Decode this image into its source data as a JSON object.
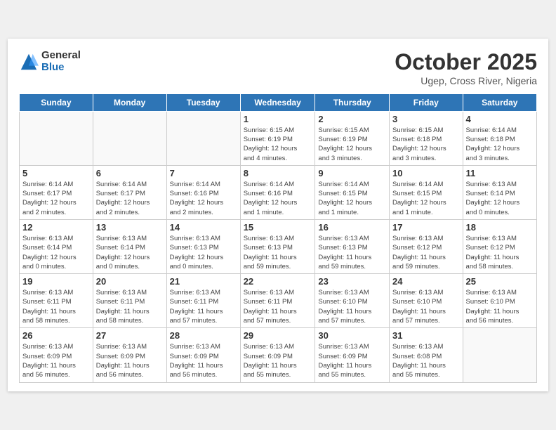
{
  "header": {
    "logo_general": "General",
    "logo_blue": "Blue",
    "month_title": "October 2025",
    "location": "Ugep, Cross River, Nigeria"
  },
  "weekdays": [
    "Sunday",
    "Monday",
    "Tuesday",
    "Wednesday",
    "Thursday",
    "Friday",
    "Saturday"
  ],
  "weeks": [
    [
      {
        "day": "",
        "info": ""
      },
      {
        "day": "",
        "info": ""
      },
      {
        "day": "",
        "info": ""
      },
      {
        "day": "1",
        "info": "Sunrise: 6:15 AM\nSunset: 6:19 PM\nDaylight: 12 hours\nand 4 minutes."
      },
      {
        "day": "2",
        "info": "Sunrise: 6:15 AM\nSunset: 6:19 PM\nDaylight: 12 hours\nand 3 minutes."
      },
      {
        "day": "3",
        "info": "Sunrise: 6:15 AM\nSunset: 6:18 PM\nDaylight: 12 hours\nand 3 minutes."
      },
      {
        "day": "4",
        "info": "Sunrise: 6:14 AM\nSunset: 6:18 PM\nDaylight: 12 hours\nand 3 minutes."
      }
    ],
    [
      {
        "day": "5",
        "info": "Sunrise: 6:14 AM\nSunset: 6:17 PM\nDaylight: 12 hours\nand 2 minutes."
      },
      {
        "day": "6",
        "info": "Sunrise: 6:14 AM\nSunset: 6:17 PM\nDaylight: 12 hours\nand 2 minutes."
      },
      {
        "day": "7",
        "info": "Sunrise: 6:14 AM\nSunset: 6:16 PM\nDaylight: 12 hours\nand 2 minutes."
      },
      {
        "day": "8",
        "info": "Sunrise: 6:14 AM\nSunset: 6:16 PM\nDaylight: 12 hours\nand 1 minute."
      },
      {
        "day": "9",
        "info": "Sunrise: 6:14 AM\nSunset: 6:15 PM\nDaylight: 12 hours\nand 1 minute."
      },
      {
        "day": "10",
        "info": "Sunrise: 6:14 AM\nSunset: 6:15 PM\nDaylight: 12 hours\nand 1 minute."
      },
      {
        "day": "11",
        "info": "Sunrise: 6:13 AM\nSunset: 6:14 PM\nDaylight: 12 hours\nand 0 minutes."
      }
    ],
    [
      {
        "day": "12",
        "info": "Sunrise: 6:13 AM\nSunset: 6:14 PM\nDaylight: 12 hours\nand 0 minutes."
      },
      {
        "day": "13",
        "info": "Sunrise: 6:13 AM\nSunset: 6:14 PM\nDaylight: 12 hours\nand 0 minutes."
      },
      {
        "day": "14",
        "info": "Sunrise: 6:13 AM\nSunset: 6:13 PM\nDaylight: 12 hours\nand 0 minutes."
      },
      {
        "day": "15",
        "info": "Sunrise: 6:13 AM\nSunset: 6:13 PM\nDaylight: 11 hours\nand 59 minutes."
      },
      {
        "day": "16",
        "info": "Sunrise: 6:13 AM\nSunset: 6:13 PM\nDaylight: 11 hours\nand 59 minutes."
      },
      {
        "day": "17",
        "info": "Sunrise: 6:13 AM\nSunset: 6:12 PM\nDaylight: 11 hours\nand 59 minutes."
      },
      {
        "day": "18",
        "info": "Sunrise: 6:13 AM\nSunset: 6:12 PM\nDaylight: 11 hours\nand 58 minutes."
      }
    ],
    [
      {
        "day": "19",
        "info": "Sunrise: 6:13 AM\nSunset: 6:11 PM\nDaylight: 11 hours\nand 58 minutes."
      },
      {
        "day": "20",
        "info": "Sunrise: 6:13 AM\nSunset: 6:11 PM\nDaylight: 11 hours\nand 58 minutes."
      },
      {
        "day": "21",
        "info": "Sunrise: 6:13 AM\nSunset: 6:11 PM\nDaylight: 11 hours\nand 57 minutes."
      },
      {
        "day": "22",
        "info": "Sunrise: 6:13 AM\nSunset: 6:11 PM\nDaylight: 11 hours\nand 57 minutes."
      },
      {
        "day": "23",
        "info": "Sunrise: 6:13 AM\nSunset: 6:10 PM\nDaylight: 11 hours\nand 57 minutes."
      },
      {
        "day": "24",
        "info": "Sunrise: 6:13 AM\nSunset: 6:10 PM\nDaylight: 11 hours\nand 57 minutes."
      },
      {
        "day": "25",
        "info": "Sunrise: 6:13 AM\nSunset: 6:10 PM\nDaylight: 11 hours\nand 56 minutes."
      }
    ],
    [
      {
        "day": "26",
        "info": "Sunrise: 6:13 AM\nSunset: 6:09 PM\nDaylight: 11 hours\nand 56 minutes."
      },
      {
        "day": "27",
        "info": "Sunrise: 6:13 AM\nSunset: 6:09 PM\nDaylight: 11 hours\nand 56 minutes."
      },
      {
        "day": "28",
        "info": "Sunrise: 6:13 AM\nSunset: 6:09 PM\nDaylight: 11 hours\nand 56 minutes."
      },
      {
        "day": "29",
        "info": "Sunrise: 6:13 AM\nSunset: 6:09 PM\nDaylight: 11 hours\nand 55 minutes."
      },
      {
        "day": "30",
        "info": "Sunrise: 6:13 AM\nSunset: 6:09 PM\nDaylight: 11 hours\nand 55 minutes."
      },
      {
        "day": "31",
        "info": "Sunrise: 6:13 AM\nSunset: 6:08 PM\nDaylight: 11 hours\nand 55 minutes."
      },
      {
        "day": "",
        "info": ""
      }
    ]
  ]
}
